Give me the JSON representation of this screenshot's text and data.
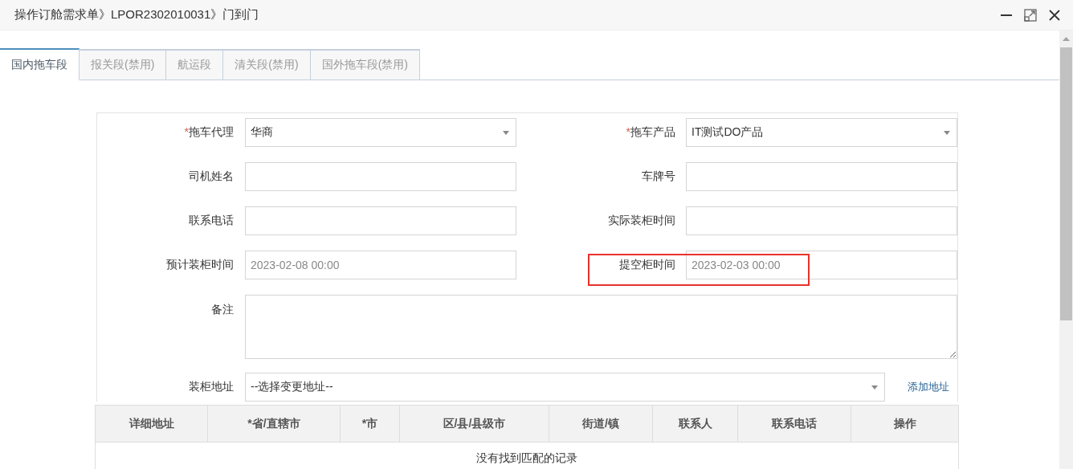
{
  "window": {
    "title": "操作订舱需求单》LPOR2302010031》门到门"
  },
  "tabs": [
    {
      "label": "国内拖车段",
      "selected": true
    },
    {
      "label": "报关段(禁用)",
      "selected": false
    },
    {
      "label": "航运段",
      "selected": false
    },
    {
      "label": "清关段(禁用)",
      "selected": false
    },
    {
      "label": "国外拖车段(禁用)",
      "selected": false
    }
  ],
  "form": {
    "fields": [
      {
        "label": "拖车代理",
        "required_mark": "*",
        "kind": "select",
        "value": "华商"
      },
      {
        "label": "拖车产品",
        "required_mark": "*",
        "kind": "select",
        "value": "IT测试DO产品"
      },
      {
        "label": "司机姓名",
        "kind": "input"
      },
      {
        "label": "车牌号",
        "kind": "input"
      },
      {
        "label": "联系电话",
        "kind": "input"
      },
      {
        "label": "实际装柜时间",
        "kind": "input"
      },
      {
        "label": "预计装柜时间",
        "kind": "date",
        "value": "2023-02-08 00:00"
      },
      {
        "label": "提空柜时间",
        "kind": "date",
        "value": "2023-02-03 00:00",
        "highlighted": true
      }
    ],
    "remark": {
      "label": "备注"
    },
    "address": {
      "label": "装柜地址",
      "value": "--选择变更地址--",
      "link": "添加地址"
    }
  },
  "table": {
    "columns": [
      "详细地址",
      "*省/直辖市",
      "*市",
      "区/县/县级市",
      "街道/镇",
      "联系人",
      "联系电话",
      "操作"
    ],
    "empty_message": "没有找到匹配的记录"
  }
}
